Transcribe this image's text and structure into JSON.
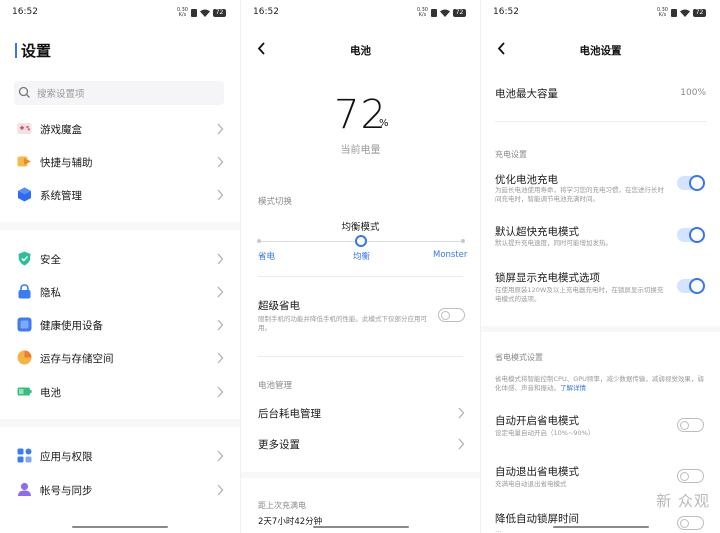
{
  "status": {
    "time": "16:52",
    "net_speed": "0.30",
    "net_unit": "K/s",
    "battery": "72"
  },
  "settings": {
    "title": "设置",
    "search_placeholder": "搜索设置项",
    "group1": [
      {
        "label": "游戏魔盒",
        "icon": "game-box-icon"
      },
      {
        "label": "快捷与辅助",
        "icon": "shortcut-icon"
      },
      {
        "label": "系统管理",
        "icon": "system-icon"
      }
    ],
    "group2": [
      {
        "label": "安全",
        "icon": "shield-icon"
      },
      {
        "label": "隐私",
        "icon": "lock-icon"
      },
      {
        "label": "健康使用设备",
        "icon": "health-icon"
      },
      {
        "label": "运存与存储空间",
        "icon": "storage-icon"
      },
      {
        "label": "电池",
        "icon": "battery-icon"
      }
    ],
    "group3": [
      {
        "label": "应用与权限",
        "icon": "apps-icon"
      },
      {
        "label": "帐号与同步",
        "icon": "account-icon"
      }
    ]
  },
  "battery": {
    "title": "电池",
    "percent": "72",
    "percent_unit": "%",
    "percent_label": "当前电量",
    "mode_section": "模式切换",
    "current_mode": "均衡模式",
    "mode_options": [
      "省电",
      "均衡",
      "Monster"
    ],
    "selected_mode_index": 1,
    "super_saver_label": "超级省电",
    "super_saver_desc": "限制手机的功能并降低手机的性能。此模式下仅部分应用可用。",
    "super_saver_on": false,
    "manage_section": "电池管理",
    "bg_power": "后台耗电管理",
    "more_settings": "更多设置",
    "since_full_label": "距上次充满电",
    "since_full_value": "2天7小时42分钟"
  },
  "battery_settings": {
    "title": "电池设置",
    "max_capacity_label": "电池最大容量",
    "max_capacity_value": "100%",
    "charge_section": "充电设置",
    "items": [
      {
        "label": "优化电池充电",
        "desc": "为延长电池使用寿命，将学习您的充电习惯，在您进行长时间充电时，智能调节电池充满时间。",
        "on": true
      },
      {
        "label": "默认超快充电模式",
        "desc": "默认提升充电速度，同时可能增加发热。",
        "on": true
      },
      {
        "label": "锁屏显示充电模式选项",
        "desc": "在使用原装120W及以上充电器充电时，在锁屏显示切换充电模式的选项。",
        "on": true
      }
    ],
    "saver_section": "省电模式设置",
    "saver_desc": "省电模式将智能控制CPU、GPU频率，减少数据传输，减弱视觉效果，弱化体感、声音和振动。",
    "saver_link": "了解详情",
    "auto_on_label": "自动开启省电模式",
    "auto_on_desc": "设定电量自动开启（10%~90%）",
    "auto_on": false,
    "auto_off_label": "自动退出省电模式",
    "auto_off_desc": "充满电自动退出省电模式",
    "auto_off": false,
    "lower_lock_label": "降低自动锁屏时间",
    "lower_lock_desc": "…",
    "watermark": "新 众观"
  },
  "colors": {
    "accent": "#3476f5",
    "toggle_on_track": "#d4e3ff",
    "divider": "#f7f7f7"
  }
}
